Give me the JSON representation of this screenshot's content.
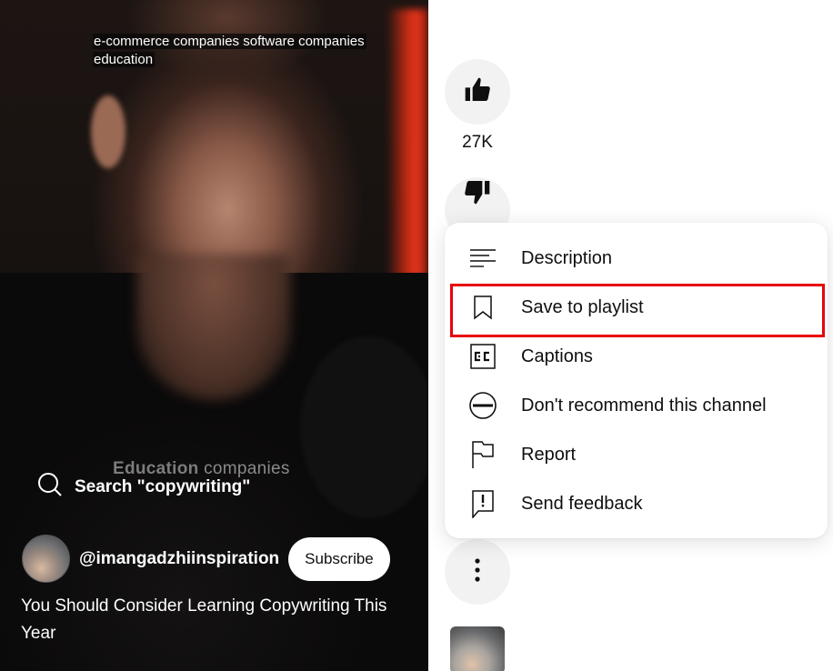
{
  "video": {
    "caption_lines": [
      "e-commerce companies software companies",
      "education"
    ],
    "watermark": {
      "bold": "Education",
      "rest": " companies"
    },
    "search_prompt": "Search \"copywriting\"",
    "channel_handle": "@imangadzhiinspiration",
    "subscribe_label": "Subscribe",
    "title": "You Should Consider Learning Copywriting This Year"
  },
  "actions": {
    "like_count": "27K",
    "like_icon": "thumbs-up-icon",
    "dislike_icon": "thumbs-down-icon",
    "more_icon": "more-vert-icon"
  },
  "menu": {
    "items": [
      {
        "label": "Description",
        "icon": "description-icon"
      },
      {
        "label": "Save to playlist",
        "icon": "bookmark-icon",
        "highlighted": true
      },
      {
        "label": "Captions",
        "icon": "cc-icon"
      },
      {
        "label": "Don't recommend this channel",
        "icon": "block-icon"
      },
      {
        "label": "Report",
        "icon": "flag-icon"
      },
      {
        "label": "Send feedback",
        "icon": "feedback-icon"
      }
    ],
    "highlight_color": "#e8000a"
  }
}
